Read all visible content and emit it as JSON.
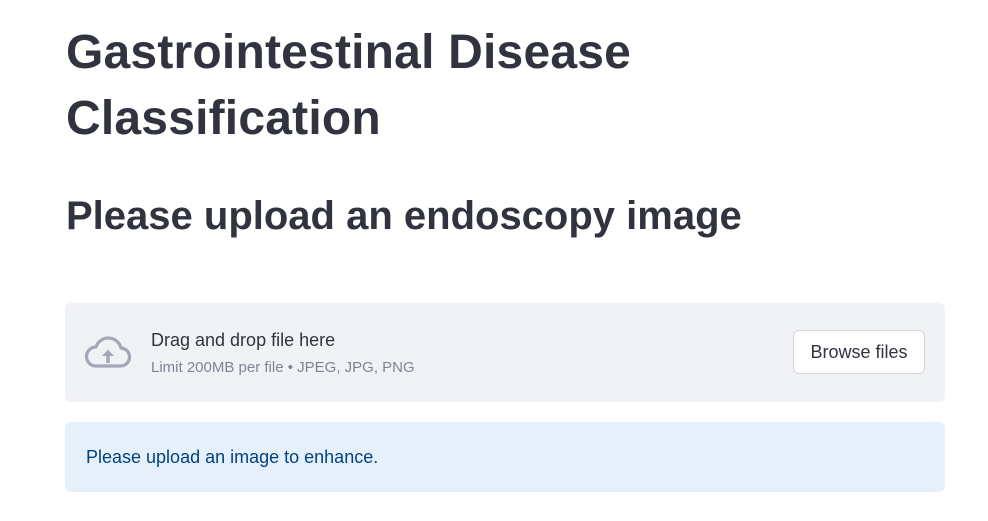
{
  "page": {
    "title": "Gastrointestinal Disease Classification",
    "subtitle": "Please upload an endoscopy image"
  },
  "uploader": {
    "icon": "cloud-upload-icon",
    "drag_label": "Drag and drop file here",
    "limit_label": "Limit 200MB per file • JPEG, JPG, PNG",
    "browse_label": "Browse files"
  },
  "info": {
    "message": "Please upload an image to enhance."
  },
  "colors": {
    "text": "#31333f",
    "dropzone_bg": "#f0f2f6",
    "info_bg": "#e6f0fb",
    "info_text": "#004280",
    "icon": "#a3a8b8"
  }
}
